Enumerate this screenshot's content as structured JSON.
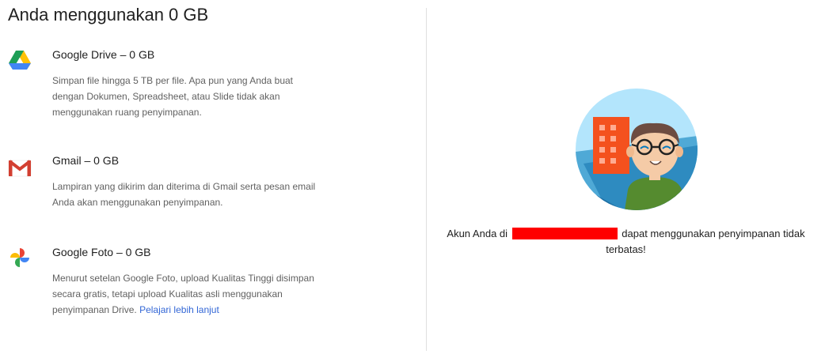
{
  "page": {
    "title": "Anda menggunakan 0 GB"
  },
  "services": {
    "drive": {
      "title": "Google Drive – 0 GB",
      "description": "Simpan file hingga 5 TB per file. Apa pun yang Anda buat dengan Dokumen, Spreadsheet, atau Slide tidak akan menggunakan ruang penyimpanan.",
      "icon": "google-drive-icon"
    },
    "gmail": {
      "title": "Gmail – 0 GB",
      "description": "Lampiran yang dikirim dan diterima di Gmail serta pesan email Anda akan menggunakan penyimpanan.",
      "icon": "gmail-icon"
    },
    "photos": {
      "title": "Google Foto – 0 GB",
      "description": "Menurut setelan Google Foto, upload Kualitas Tinggi disimpan secara gratis, tetapi upload Kualitas asli menggunakan penyimpanan Drive.",
      "link_text": "Pelajari lebih lanjut",
      "icon": "google-photos-icon"
    }
  },
  "storage_message": {
    "prefix": "Akun Anda di",
    "suffix": "dapat menggunakan penyimpanan tidak terbatas!"
  },
  "colors": {
    "link": "#3367d6",
    "redaction": "#ff0000",
    "divider": "#e0e0e0"
  }
}
